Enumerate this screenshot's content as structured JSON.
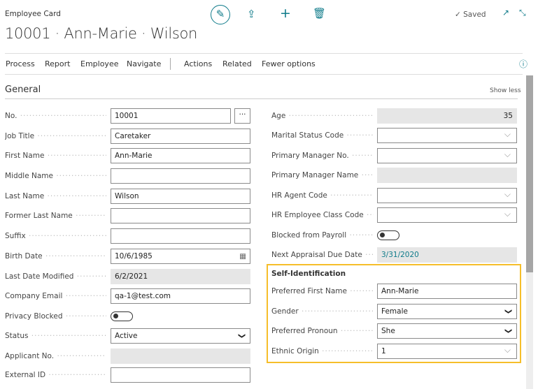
{
  "header": {
    "caption": "Employee Card",
    "title": "10001 · Ann-Marie · Wilson",
    "saved": "✓ Saved"
  },
  "actions": [
    "Process",
    "Report",
    "Employee",
    "Navigate",
    "Actions",
    "Related",
    "Fewer options"
  ],
  "section": {
    "title": "General",
    "toggle": "Show less"
  },
  "left": [
    {
      "label": "No.",
      "value": "10001",
      "type": "text"
    },
    {
      "label": "Job Title",
      "value": "Caretaker",
      "type": "text"
    },
    {
      "label": "First Name",
      "value": "Ann-Marie",
      "type": "text"
    },
    {
      "label": "Middle Name",
      "value": "",
      "type": "text"
    },
    {
      "label": "Last Name",
      "value": "Wilson",
      "type": "text"
    },
    {
      "label": "Former Last Name",
      "value": "",
      "type": "text"
    },
    {
      "label": "Suffix",
      "value": "",
      "type": "text"
    },
    {
      "label": "Birth Date",
      "value": "10/6/1985",
      "type": "date"
    },
    {
      "label": "Last Date Modified",
      "value": "6/2/2021",
      "type": "readonly"
    },
    {
      "label": "Company Email",
      "value": "qa-1@test.com",
      "type": "text"
    },
    {
      "label": "Privacy Blocked",
      "value": false,
      "type": "toggle"
    },
    {
      "label": "Status",
      "value": "Active",
      "type": "select"
    },
    {
      "label": "Applicant No.",
      "value": "",
      "type": "readonly"
    },
    {
      "label": "External ID",
      "value": "",
      "type": "text"
    }
  ],
  "right": [
    {
      "label": "Age",
      "value": "35",
      "type": "readonly"
    },
    {
      "label": "Marital Status Code",
      "value": "",
      "type": "lookup"
    },
    {
      "label": "Primary Manager No.",
      "value": "",
      "type": "lookup"
    },
    {
      "label": "Primary Manager Name",
      "value": "",
      "type": "readonly"
    },
    {
      "label": "HR Agent Code",
      "value": "",
      "type": "lookup"
    },
    {
      "label": "HR Employee Class Code",
      "value": "",
      "type": "lookup"
    },
    {
      "label": "Blocked from Payroll",
      "value": false,
      "type": "toggle"
    },
    {
      "label": "Next Appraisal Due Date",
      "value": "3/31/2020",
      "type": "readonly"
    }
  ],
  "self_identification": {
    "title": "Self-Identification",
    "fields": [
      {
        "label": "Preferred First Name",
        "value": "Ann-Marie",
        "type": "text"
      },
      {
        "label": "Gender",
        "value": "Female",
        "type": "select"
      },
      {
        "label": "Preferred Pronoun",
        "value": "She",
        "type": "select"
      },
      {
        "label": "Ethnic Origin",
        "value": "1",
        "type": "lookup"
      }
    ]
  },
  "colors": {
    "accent": "#0f7b8a",
    "highlight": "#f6be2a"
  }
}
